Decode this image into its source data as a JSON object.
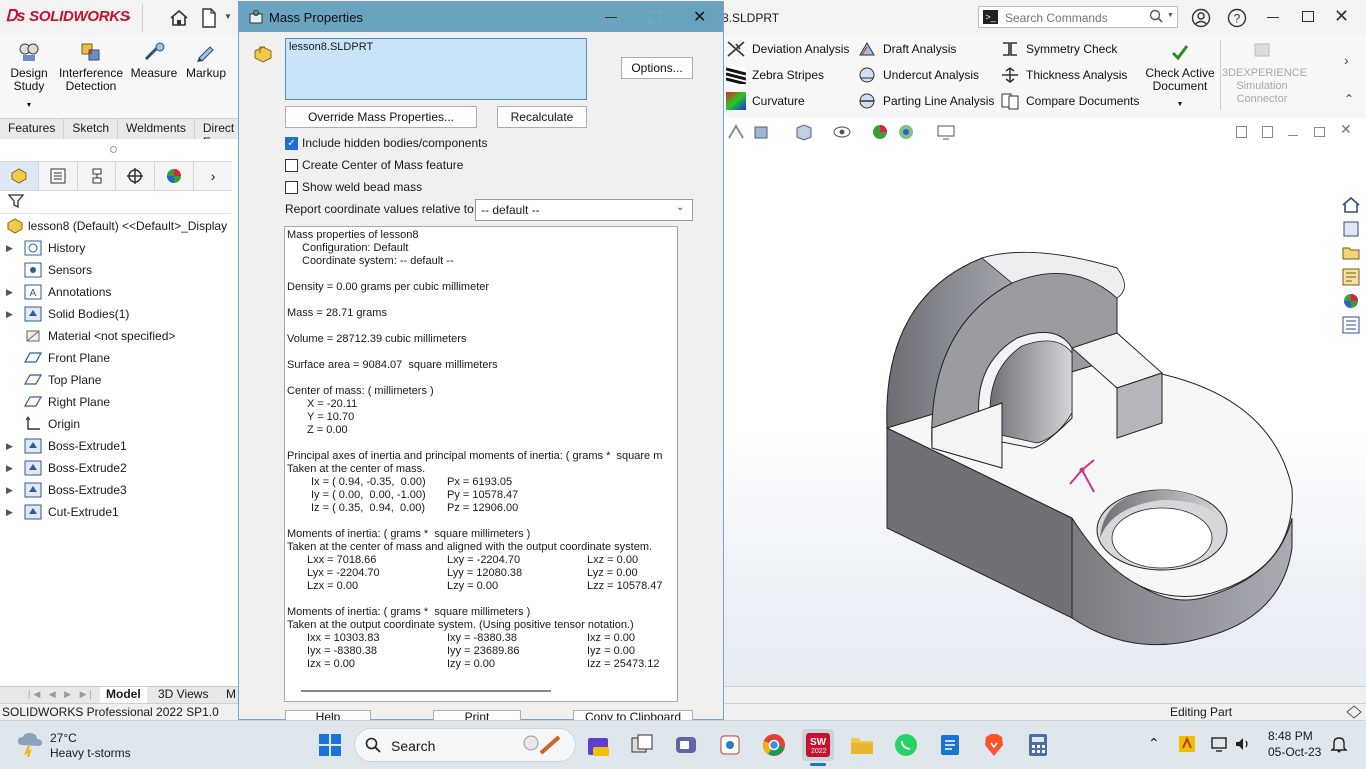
{
  "app": {
    "logo_text": "SOLIDWORKS",
    "document_title": "8.SLDPRT",
    "search_placeholder": "Search Commands"
  },
  "command_manager": {
    "big_buttons": [
      {
        "label1": "Design",
        "label2": "Study",
        "icon": "design-study-icon"
      },
      {
        "label1": "Interference",
        "label2": "Detection",
        "icon": "interference-detection-icon"
      },
      {
        "label1": "Measure",
        "label2": "",
        "icon": "measure-icon"
      },
      {
        "label1": "Markup",
        "label2": "",
        "icon": "markup-icon"
      }
    ],
    "col1": [
      "Deviation Analysis",
      "Zebra Stripes",
      "Curvature"
    ],
    "col2": [
      "Draft Analysis",
      "Undercut Analysis",
      "Parting Line Analysis"
    ],
    "col3": [
      "Symmetry Check",
      "Thickness Analysis",
      "Compare Documents"
    ],
    "check_active": {
      "label1": "Check Active",
      "label2": "Document"
    },
    "experience": {
      "label1": "3DEXPERIENCE",
      "label2": "Simulation",
      "label3": "Connector"
    }
  },
  "tabs": [
    "Features",
    "Sketch",
    "Weldments",
    "Direct E"
  ],
  "feature_tree": {
    "root": "lesson8 (Default) <<Default>_Display",
    "items": [
      {
        "label": "History",
        "expandable": true,
        "icon": "history-folder-icon"
      },
      {
        "label": "Sensors",
        "expandable": false,
        "icon": "sensors-icon"
      },
      {
        "label": "Annotations",
        "expandable": true,
        "icon": "annotations-icon"
      },
      {
        "label": "Solid Bodies(1)",
        "expandable": true,
        "icon": "solid-bodies-icon"
      },
      {
        "label": "Material <not specified>",
        "expandable": false,
        "icon": "material-icon"
      },
      {
        "label": "Front Plane",
        "expandable": false,
        "icon": "plane-icon"
      },
      {
        "label": "Top Plane",
        "expandable": false,
        "icon": "plane-icon"
      },
      {
        "label": "Right Plane",
        "expandable": false,
        "icon": "plane-icon"
      },
      {
        "label": "Origin",
        "expandable": false,
        "icon": "origin-icon"
      },
      {
        "label": "Boss-Extrude1",
        "expandable": true,
        "icon": "boss-extrude-icon"
      },
      {
        "label": "Boss-Extrude2",
        "expandable": true,
        "icon": "boss-extrude-icon"
      },
      {
        "label": "Boss-Extrude3",
        "expandable": true,
        "icon": "boss-extrude-icon"
      },
      {
        "label": "Cut-Extrude1",
        "expandable": true,
        "icon": "cut-extrude-icon"
      }
    ]
  },
  "model_tabs": [
    "Model",
    "3D Views",
    "M"
  ],
  "status": {
    "left": "SOLIDWORKS Professional 2022 SP1.0",
    "right": "Editing Part"
  },
  "dialog": {
    "title": "Mass Properties",
    "selection": "lesson8.SLDPRT",
    "options_btn": "Options...",
    "override_btn": "Override Mass Properties...",
    "recalc_btn": "Recalculate",
    "include_hidden": "Include hidden bodies/components",
    "create_com": "Create Center of Mass feature",
    "show_weld": "Show weld bead mass",
    "report_label": "Report coordinate values relative to:",
    "report_value": "-- default --",
    "help_btn": "Help",
    "print_btn": "Print",
    "copy_btn": "Copy to Clipboard",
    "results": {
      "l1": "Mass properties of lesson8",
      "l2": "Configuration: Default",
      "l3": "Coordinate system: -- default --",
      "density": "Density = 0.00 grams per cubic millimeter",
      "mass": "Mass = 28.71 grams",
      "volume": "Volume = 28712.39 cubic millimeters",
      "surface": "Surface area = 9084.07  square millimeters",
      "com_h": "Center of mass: ( millimeters )",
      "cx": "X = -20.11",
      "cy": "Y = 10.70",
      "cz": "Z = 0.00",
      "pa_h": "Principal axes of inertia and principal moments of inertia: ( grams *  square m",
      "pa_h2": "Taken at the center of mass.",
      "ix": "Ix = ( 0.94, -0.35,  0.00)",
      "iy": "Iy = ( 0.00,  0.00, -1.00)",
      "iz": "Iz = ( 0.35,  0.94,  0.00)",
      "px": "Px = 6193.05",
      "py": "Py = 10578.47",
      "pz": "Pz = 12906.00",
      "m1_h": "Moments of inertia: ( grams *  square millimeters )",
      "m1_h2": "Taken at the center of mass and aligned with the output coordinate system.",
      "lxx": "Lxx = 7018.66",
      "lxy": "Lxy = -2204.70",
      "lxz": "Lxz = 0.00",
      "lyx": "Lyx = -2204.70",
      "lyy": "Lyy = 12080.38",
      "lyz": "Lyz = 0.00",
      "lzx": "Lzx = 0.00",
      "lzy": "Lzy = 0.00",
      "lzz": "Lzz = 10578.47",
      "m2_h": "Moments of inertia: ( grams *  square millimeters )",
      "m2_h2": "Taken at the output coordinate system. (Using positive tensor notation.)",
      "ixx": "Ixx = 10303.83",
      "ixy": "Ixy = -8380.38",
      "ixz": "Ixz = 0.00",
      "iyx": "Iyx = -8380.38",
      "iyy": "Iyy = 23689.86",
      "iyz": "Iyz = 0.00",
      "izx": "Izx = 0.00",
      "izy": "Izy = 0.00",
      "izz": "Izz = 25473.12"
    }
  },
  "taskbar": {
    "weather_temp": "27°C",
    "weather_desc": "Heavy t-storms",
    "search_label": "Search",
    "time": "8:48 PM",
    "date": "05-Oct-23",
    "sw_badge": "2022"
  }
}
